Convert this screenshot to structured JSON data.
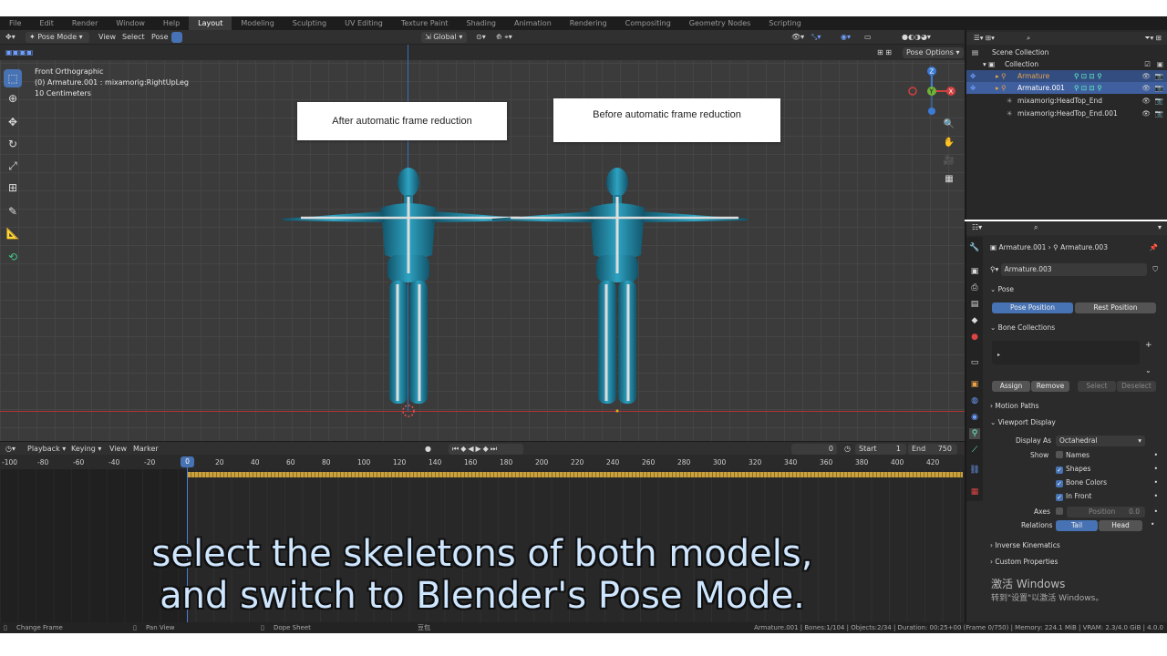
{
  "menu": {
    "items": [
      "File",
      "Edit",
      "Render",
      "Window",
      "Help",
      "Layout",
      "Modeling",
      "Sculpting",
      "UV Editing",
      "Texture Paint",
      "Shading",
      "Animation",
      "Rendering",
      "Compositing",
      "Geometry Nodes",
      "Scripting"
    ],
    "active": "Layout"
  },
  "viewport_header": {
    "mode": "Pose Mode",
    "view": "View",
    "select": "Select",
    "pose": "Pose",
    "orientation": "Global",
    "pose_options": "Pose Options"
  },
  "viewport": {
    "overlay_title": "Front Orthographic",
    "overlay_object": "(0) Armature.001 : mixamorig:RightUpLeg",
    "overlay_scale": "10 Centimeters",
    "label_left": "After automatic frame reduction",
    "label_right": "Before automatic frame reduction"
  },
  "outliner": {
    "scene_collection": "Scene Collection",
    "collection": "Collection",
    "rows": [
      "Armature",
      "Armature.001",
      "mixamorig:HeadTop_End",
      "mixamorig:HeadTop_End.001"
    ]
  },
  "properties": {
    "breadcrumb_a": "Armature.001",
    "breadcrumb_b": "Armature.003",
    "data_name": "Armature.003",
    "pose_section": "Pose",
    "pose_position": "Pose Position",
    "rest_position": "Rest Position",
    "bone_collections": "Bone Collections",
    "assign": "Assign",
    "remove": "Remove",
    "select": "Select",
    "deselect": "Deselect",
    "motion_paths": "Motion Paths",
    "viewport_display": "Viewport Display",
    "display_as_label": "Display As",
    "display_as_value": "Octahedral",
    "show_label": "Show",
    "names": "Names",
    "shapes": "Shapes",
    "bone_colors": "Bone Colors",
    "in_front": "In Front",
    "axes_label": "Axes",
    "position_label": "Position",
    "position_value": "0.0",
    "relations_label": "Relations",
    "tail": "Tail",
    "head": "Head",
    "inverse_kinematics": "Inverse Kinematics",
    "custom_properties": "Custom Properties"
  },
  "timeline": {
    "playback": "Playback",
    "keying": "Keying",
    "view": "View",
    "marker": "Marker",
    "current_frame": "0",
    "start_label": "Start",
    "start_value": "1",
    "end_label": "End",
    "end_value": "750",
    "ticks": [
      "-100",
      "-80",
      "-60",
      "-40",
      "-20",
      "0",
      "20",
      "40",
      "60",
      "80",
      "100",
      "120",
      "140",
      "160",
      "180",
      "200",
      "220",
      "240",
      "260",
      "280",
      "300",
      "320",
      "340",
      "360",
      "380",
      "400",
      "420"
    ],
    "playhead_frame": "0"
  },
  "statusbar": {
    "change_frame": "Change Frame",
    "pan_view": "Pan View",
    "dope_sheet": "Dope Sheet",
    "mid_label": "豆包",
    "stats": "Armature.001 | Bones:1/104 | Objects:2/34 | Duration: 00:25+00 (Frame 0/750) | Memory: 224.1 MiB | VRAM: 2.3/4.0 GiB | 4.0.0"
  },
  "subtitle": {
    "line1": "select the skeletons of both models,",
    "line2": "and switch to Blender's Pose Mode."
  },
  "watermark": {
    "title": "激活 Windows",
    "sub": "转到\"设置\"以激活 Windows。"
  },
  "colors": {
    "accent": "#4772b3",
    "model": "#2a8fae",
    "keyframe": "#c9a13e"
  }
}
